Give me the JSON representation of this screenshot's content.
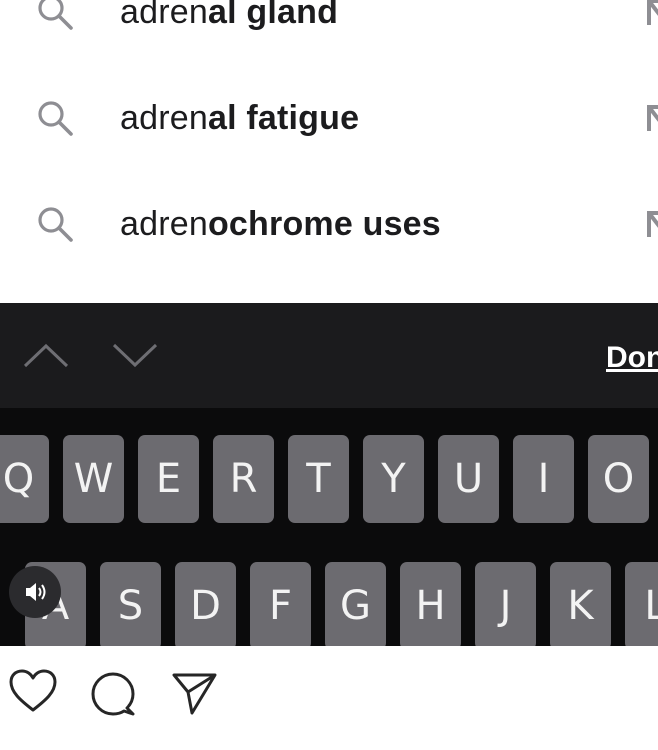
{
  "suggestions": [
    {
      "typed": "adren",
      "completion": "al gland",
      "icon": "search-icon",
      "arrow": "fill-arrow-icon"
    },
    {
      "typed": "adren",
      "completion": "al fatigue",
      "icon": "search-icon",
      "arrow": "fill-arrow-icon"
    },
    {
      "typed": "adren",
      "completion": "ochrome uses",
      "icon": "search-icon",
      "arrow": "fill-arrow-icon"
    }
  ],
  "accessory_bar": {
    "prev_icon": "chevron-up-icon",
    "next_icon": "chevron-down-icon",
    "done_label": "Done"
  },
  "keyboard": {
    "row1": [
      "Q",
      "W",
      "E",
      "R",
      "T",
      "Y",
      "U",
      "I",
      "O"
    ],
    "row2": [
      "A",
      "S",
      "D",
      "F",
      "G",
      "H",
      "J",
      "K",
      "L"
    ],
    "sound_icon": "speaker-icon"
  },
  "actions": {
    "like_icon": "heart-icon",
    "comment_icon": "comment-icon",
    "share_icon": "send-icon"
  },
  "colors": {
    "keyboard_bg": "#0b0b0c",
    "accessory_bg": "#1b1b1d",
    "key_bg": "#6c6b70",
    "key_text": "#f3f3f3",
    "suggestion_text": "#1c1c1e",
    "icon_gray": "#8e8e93"
  }
}
